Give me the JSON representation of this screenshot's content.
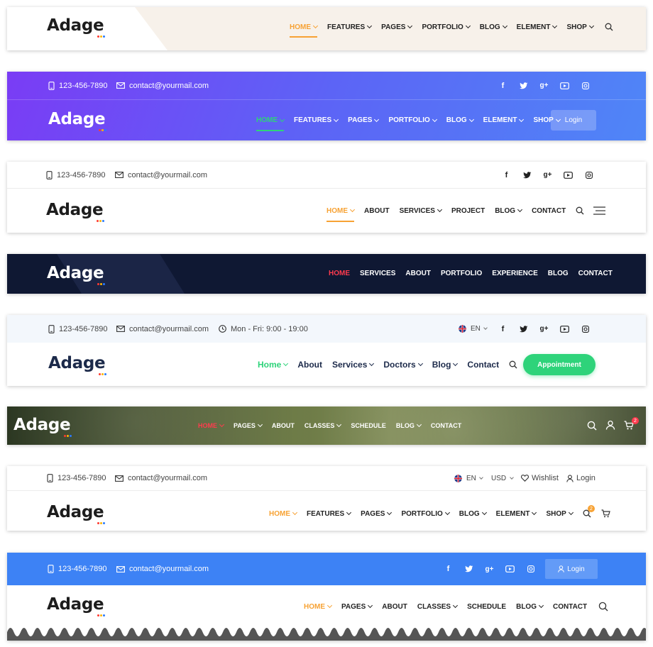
{
  "brand": "Adage",
  "contact": {
    "phone": "123-456-7890",
    "email": "contact@yourmail.com",
    "hours": "Mon - Fri: 9:00 - 19:00"
  },
  "socials": [
    "facebook",
    "twitter",
    "google-plus",
    "youtube",
    "instagram"
  ],
  "colors": {
    "orange": "#f7a234",
    "green": "#2ed37a",
    "purple_start": "#7a3cf5",
    "blue_end": "#4f86f7",
    "navy": "#0f1833",
    "red": "#ff3b4e",
    "blue": "#3d82f5"
  },
  "header1": {
    "nav": [
      "HOME",
      "FEATURES",
      "PAGES",
      "PORTFOLIO",
      "BLOG",
      "ELEMENT",
      "SHOP"
    ]
  },
  "header2": {
    "nav": [
      "HOME",
      "FEATURES",
      "PAGES",
      "PORTFOLIO",
      "BLOG",
      "ELEMENT",
      "SHOP"
    ],
    "login": "Login"
  },
  "header3": {
    "nav": [
      "HOME",
      "ABOUT",
      "SERVICES",
      "PROJECT",
      "BLOG",
      "CONTACT"
    ]
  },
  "header4": {
    "nav": [
      "HOME",
      "SERVICES",
      "ABOUT",
      "PORTFOLIO",
      "EXPERIENCE",
      "BLOG",
      "CONTACT"
    ]
  },
  "header5": {
    "language": "EN",
    "nav": [
      "Home",
      "About",
      "Services",
      "Doctors",
      "Blog",
      "Contact"
    ],
    "appointment": "Appointment"
  },
  "header6": {
    "nav": [
      "HOME",
      "PAGES",
      "ABOUT",
      "CLASSES",
      "SCHEDULE",
      "BLOG",
      "CONTACT"
    ],
    "cart_count": "2"
  },
  "header7": {
    "language": "EN",
    "currency": "USD",
    "wishlist": "Wishlist",
    "login": "Login",
    "nav": [
      "HOME",
      "FEATURES",
      "PAGES",
      "PORTFOLIO",
      "BLOG",
      "ELEMENT",
      "SHOP"
    ],
    "cart_count": "2"
  },
  "header8": {
    "login": "Login",
    "nav": [
      "HOME",
      "PAGES",
      "ABOUT",
      "CLASSES",
      "SCHEDULE",
      "BLOG",
      "CONTACT"
    ]
  }
}
